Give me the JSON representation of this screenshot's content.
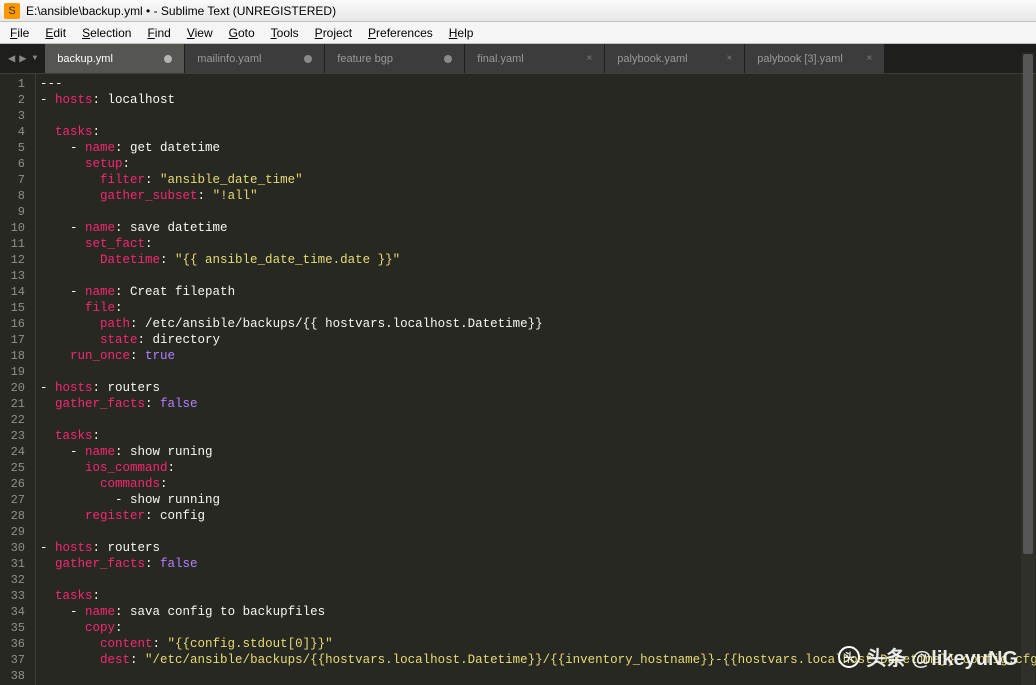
{
  "window": {
    "title": "E:\\ansible\\backup.yml • - Sublime Text (UNREGISTERED)"
  },
  "menu": {
    "items": [
      "File",
      "Edit",
      "Selection",
      "Find",
      "View",
      "Goto",
      "Tools",
      "Project",
      "Preferences",
      "Help"
    ],
    "mnemonic_index": [
      0,
      0,
      0,
      0,
      0,
      0,
      0,
      0,
      0,
      0
    ]
  },
  "tabs": [
    {
      "label": "backup.yml",
      "active": true,
      "dirty": true
    },
    {
      "label": "mailinfo.yaml",
      "active": false,
      "dirty": true
    },
    {
      "label": "feature bgp",
      "active": false,
      "dirty": true
    },
    {
      "label": "final.yaml",
      "active": false,
      "dirty": false
    },
    {
      "label": "palybook.yaml",
      "active": false,
      "dirty": false
    },
    {
      "label": "palybook [3].yaml",
      "active": false,
      "dirty": false
    }
  ],
  "code": {
    "lines": [
      [
        {
          "t": "---",
          "c": "c-white"
        }
      ],
      [
        {
          "t": "- ",
          "c": "c-dash"
        },
        {
          "t": "hosts",
          "c": "c-key"
        },
        {
          "t": ": ",
          "c": "c-punc"
        },
        {
          "t": "localhost",
          "c": "c-white"
        }
      ],
      [],
      [
        {
          "t": "  ",
          "c": "c-white"
        },
        {
          "t": "tasks",
          "c": "c-key"
        },
        {
          "t": ":",
          "c": "c-punc"
        }
      ],
      [
        {
          "t": "    - ",
          "c": "c-dash"
        },
        {
          "t": "name",
          "c": "c-key"
        },
        {
          "t": ": ",
          "c": "c-punc"
        },
        {
          "t": "get datetime",
          "c": "c-white"
        }
      ],
      [
        {
          "t": "      ",
          "c": "c-white"
        },
        {
          "t": "setup",
          "c": "c-key"
        },
        {
          "t": ":",
          "c": "c-punc"
        }
      ],
      [
        {
          "t": "        ",
          "c": "c-white"
        },
        {
          "t": "filter",
          "c": "c-key"
        },
        {
          "t": ": ",
          "c": "c-punc"
        },
        {
          "t": "\"ansible_date_time\"",
          "c": "c-str"
        }
      ],
      [
        {
          "t": "        ",
          "c": "c-white"
        },
        {
          "t": "gather_subset",
          "c": "c-key"
        },
        {
          "t": ": ",
          "c": "c-punc"
        },
        {
          "t": "\"!all\"",
          "c": "c-str"
        }
      ],
      [],
      [
        {
          "t": "    - ",
          "c": "c-dash"
        },
        {
          "t": "name",
          "c": "c-key"
        },
        {
          "t": ": ",
          "c": "c-punc"
        },
        {
          "t": "save datetime",
          "c": "c-white"
        }
      ],
      [
        {
          "t": "      ",
          "c": "c-white"
        },
        {
          "t": "set_fact",
          "c": "c-key"
        },
        {
          "t": ":",
          "c": "c-punc"
        }
      ],
      [
        {
          "t": "        ",
          "c": "c-white"
        },
        {
          "t": "Datetime",
          "c": "c-key"
        },
        {
          "t": ": ",
          "c": "c-punc"
        },
        {
          "t": "\"{{ ansible_date_time.date }}\"",
          "c": "c-str"
        }
      ],
      [],
      [
        {
          "t": "    - ",
          "c": "c-dash"
        },
        {
          "t": "name",
          "c": "c-key"
        },
        {
          "t": ": ",
          "c": "c-punc"
        },
        {
          "t": "Creat filepath",
          "c": "c-white"
        }
      ],
      [
        {
          "t": "      ",
          "c": "c-white"
        },
        {
          "t": "file",
          "c": "c-key"
        },
        {
          "t": ":",
          "c": "c-punc"
        }
      ],
      [
        {
          "t": "        ",
          "c": "c-white"
        },
        {
          "t": "path",
          "c": "c-key"
        },
        {
          "t": ": ",
          "c": "c-punc"
        },
        {
          "t": "/etc/ansible/backups/{{ hostvars.localhost.Datetime}}",
          "c": "c-white"
        }
      ],
      [
        {
          "t": "        ",
          "c": "c-white"
        },
        {
          "t": "state",
          "c": "c-key"
        },
        {
          "t": ": ",
          "c": "c-punc"
        },
        {
          "t": "directory",
          "c": "c-white"
        }
      ],
      [
        {
          "t": "    ",
          "c": "c-white"
        },
        {
          "t": "run_once",
          "c": "c-key"
        },
        {
          "t": ": ",
          "c": "c-punc"
        },
        {
          "t": "true",
          "c": "c-bool"
        }
      ],
      [],
      [
        {
          "t": "- ",
          "c": "c-dash"
        },
        {
          "t": "hosts",
          "c": "c-key"
        },
        {
          "t": ": ",
          "c": "c-punc"
        },
        {
          "t": "routers",
          "c": "c-white"
        }
      ],
      [
        {
          "t": "  ",
          "c": "c-white"
        },
        {
          "t": "gather_facts",
          "c": "c-key"
        },
        {
          "t": ": ",
          "c": "c-punc"
        },
        {
          "t": "false",
          "c": "c-bool"
        }
      ],
      [],
      [
        {
          "t": "  ",
          "c": "c-white"
        },
        {
          "t": "tasks",
          "c": "c-key"
        },
        {
          "t": ":",
          "c": "c-punc"
        }
      ],
      [
        {
          "t": "    - ",
          "c": "c-dash"
        },
        {
          "t": "name",
          "c": "c-key"
        },
        {
          "t": ": ",
          "c": "c-punc"
        },
        {
          "t": "show runing",
          "c": "c-white"
        }
      ],
      [
        {
          "t": "      ",
          "c": "c-white"
        },
        {
          "t": "ios_command",
          "c": "c-key"
        },
        {
          "t": ":",
          "c": "c-punc"
        }
      ],
      [
        {
          "t": "        ",
          "c": "c-white"
        },
        {
          "t": "commands",
          "c": "c-key"
        },
        {
          "t": ":",
          "c": "c-punc"
        }
      ],
      [
        {
          "t": "          - show running",
          "c": "c-white"
        }
      ],
      [
        {
          "t": "      ",
          "c": "c-white"
        },
        {
          "t": "register",
          "c": "c-key"
        },
        {
          "t": ": ",
          "c": "c-punc"
        },
        {
          "t": "config",
          "c": "c-white"
        }
      ],
      [],
      [
        {
          "t": "- ",
          "c": "c-dash"
        },
        {
          "t": "hosts",
          "c": "c-key"
        },
        {
          "t": ": ",
          "c": "c-punc"
        },
        {
          "t": "routers",
          "c": "c-white"
        }
      ],
      [
        {
          "t": "  ",
          "c": "c-white"
        },
        {
          "t": "gather_facts",
          "c": "c-key"
        },
        {
          "t": ": ",
          "c": "c-punc"
        },
        {
          "t": "false",
          "c": "c-bool"
        }
      ],
      [],
      [
        {
          "t": "  ",
          "c": "c-white"
        },
        {
          "t": "tasks",
          "c": "c-key"
        },
        {
          "t": ":",
          "c": "c-punc"
        }
      ],
      [
        {
          "t": "    - ",
          "c": "c-dash"
        },
        {
          "t": "name",
          "c": "c-key"
        },
        {
          "t": ": ",
          "c": "c-punc"
        },
        {
          "t": "sava config to backupfiles",
          "c": "c-white"
        }
      ],
      [
        {
          "t": "      ",
          "c": "c-white"
        },
        {
          "t": "copy",
          "c": "c-key"
        },
        {
          "t": ":",
          "c": "c-punc"
        }
      ],
      [
        {
          "t": "        ",
          "c": "c-white"
        },
        {
          "t": "content",
          "c": "c-key"
        },
        {
          "t": ": ",
          "c": "c-punc"
        },
        {
          "t": "\"{{config.stdout[0]}}\"",
          "c": "c-str"
        }
      ],
      [
        {
          "t": "        ",
          "c": "c-white"
        },
        {
          "t": "dest",
          "c": "c-key"
        },
        {
          "t": ": ",
          "c": "c-punc"
        },
        {
          "t": "\"/etc/ansible/backups/{{hostvars.localhost.Datetime}}/{{inventory_hostname}}-{{hostvars.localhost.Datetime}}-config.cfg",
          "c": "c-str"
        }
      ],
      []
    ]
  },
  "watermark": {
    "text": "头条 @likeyuNG"
  }
}
